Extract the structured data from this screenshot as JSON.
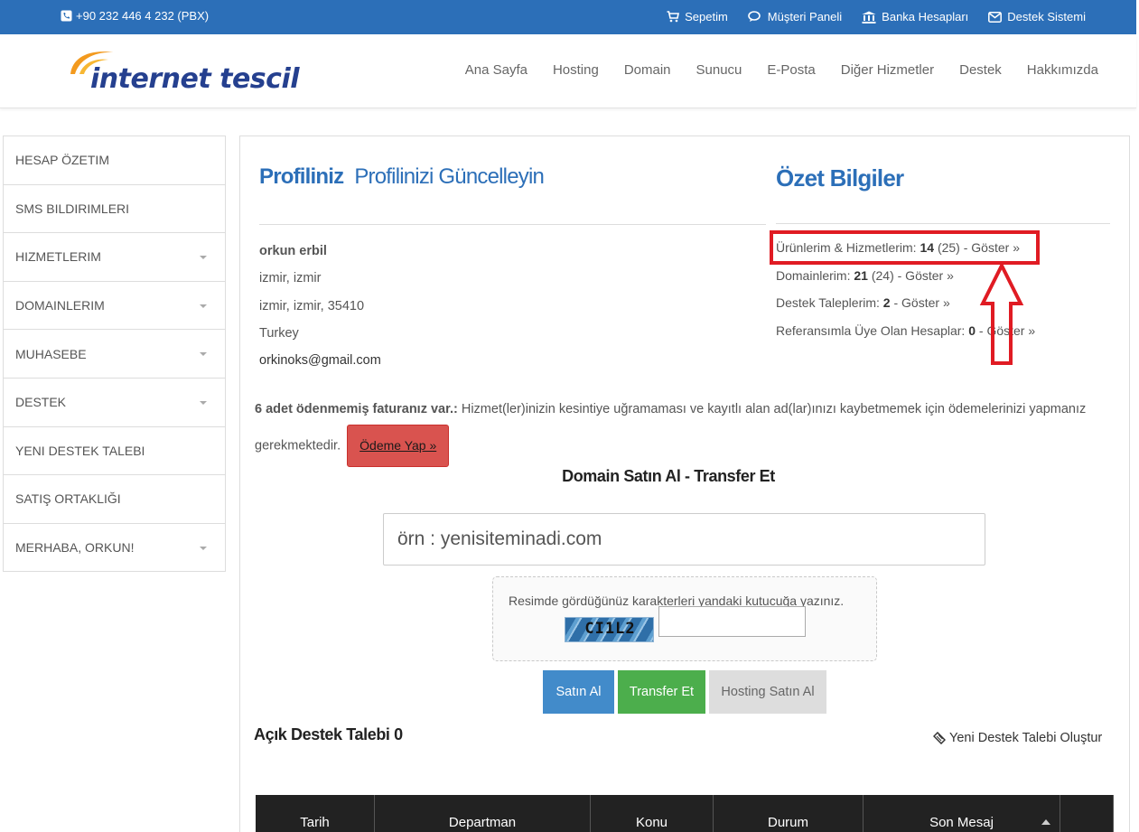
{
  "topbar": {
    "phone": "+90 232 446 4 232 (PBX)",
    "links": [
      {
        "label": "Sepetim",
        "icon": "cart-icon"
      },
      {
        "label": "Müşteri Paneli",
        "icon": "chat-icon"
      },
      {
        "label": "Banka Hesapları",
        "icon": "bank-icon"
      },
      {
        "label": "Destek Sistemi",
        "icon": "envelope-icon"
      }
    ]
  },
  "logo": {
    "text": "internet tescil"
  },
  "nav": [
    "Ana Sayfa",
    "Hosting",
    "Domain",
    "Sunucu",
    "E-Posta",
    "Diğer Hizmetler",
    "Destek",
    "Hakkımızda"
  ],
  "sidebar": {
    "items": [
      {
        "label": "HESAP ÖZETIM",
        "dropdown": false
      },
      {
        "label": "SMS BILDIRIMLERI",
        "dropdown": false
      },
      {
        "label": "HIZMETLERIM",
        "dropdown": true
      },
      {
        "label": "DOMAINLERIM",
        "dropdown": true
      },
      {
        "label": "MUHASEBE",
        "dropdown": true
      },
      {
        "label": "DESTEK",
        "dropdown": true
      },
      {
        "label": "YENI DESTEK TALEBI",
        "dropdown": false
      },
      {
        "label": "SATIŞ ORTAKLIĞI",
        "dropdown": false
      },
      {
        "label": "MERHABA, ORKUN!",
        "dropdown": true
      }
    ]
  },
  "profile": {
    "title": "Profiliniz",
    "update_link": "Profilinizi Güncelleyin",
    "name": "orkun erbil",
    "line1": "izmir, izmir",
    "line2": "izmir, izmir, 35410",
    "country": "Turkey",
    "email": "orkinoks@gmail.com"
  },
  "summary": {
    "title": "Özet Bilgiler",
    "products": {
      "label": "Ürünlerim & Hizmetlerim:",
      "count": "14",
      "total": "(25)",
      "link": "- Göster »"
    },
    "domains": {
      "label": "Domainlerim:",
      "count": "21",
      "total": "(24)",
      "link": "- Göster »"
    },
    "tickets": {
      "label": "Destek Taleplerim:",
      "count": "2",
      "link": "- Göster »"
    },
    "referrals": {
      "label": "Referansımla Üye Olan Hesaplar:",
      "count": "0",
      "link": "- Göster »"
    }
  },
  "notice": {
    "bold": "6 adet ödenmemiş faturanız var.:",
    "text": "Hizmet(ler)inizin kesintiye uğramaması ve kayıtlı alan ad(lar)ınızı kaybetmemek için ödemelerinizi yapmanız gerekmektedir.",
    "pay_button": "Ödeme Yap »"
  },
  "domain_search": {
    "title": "Domain Satın Al - Transfer Et",
    "placeholder": "örn : yenisiteminadi.com",
    "captcha_prompt": "Resimde gördüğünüz karakterleri yandaki kutucuğa yazınız.",
    "captcha_code": "CI1L2",
    "buttons": {
      "buy": "Satın Al",
      "transfer": "Transfer Et",
      "hosting": "Hosting Satın Al"
    }
  },
  "tickets": {
    "title": "Açık Destek Talebi 0",
    "new_link": "Yeni Destek Talebi Oluştur",
    "columns": [
      "Tarih",
      "Departman",
      "Konu",
      "Durum",
      "Son Mesaj",
      ""
    ]
  },
  "colors": {
    "brand_blue": "#2c6fb8",
    "highlight_red": "#e01b23",
    "pay_red": "#d9534f",
    "buy_blue": "#428bca",
    "transfer_green": "#4cae4c"
  }
}
